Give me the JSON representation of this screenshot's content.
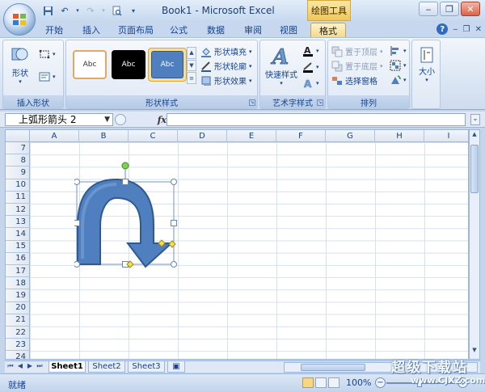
{
  "window": {
    "title": "Book1 - Microsoft Excel",
    "context_tab": "绘图工具"
  },
  "tabs": [
    "开始",
    "插入",
    "页面布局",
    "公式",
    "数据",
    "审阅",
    "视图",
    "格式"
  ],
  "active_tab": "格式",
  "ribbon": {
    "insert_shapes": {
      "label": "插入形状",
      "shapes_btn": "形状"
    },
    "shape_styles": {
      "label": "形状样式",
      "thumbs": [
        "Abc",
        "Abc",
        "Abc"
      ],
      "fill": "形状填充",
      "outline": "形状轮廓",
      "effects": "形状效果"
    },
    "wordart": {
      "label": "艺术字样式",
      "quick_styles": "快速样式"
    },
    "arrange": {
      "label": "排列",
      "bring_front": "置于顶层",
      "send_back": "置于底层",
      "selection_pane": "选择窗格"
    },
    "size": {
      "label": "大小"
    }
  },
  "formula_bar": {
    "name_box": "上弧形箭头 2",
    "fx": "fx"
  },
  "columns": [
    "A",
    "B",
    "C",
    "D",
    "E",
    "F",
    "G",
    "H",
    "I"
  ],
  "rows": [
    "7",
    "8",
    "9",
    "10",
    "11",
    "12",
    "13",
    "14",
    "15",
    "16",
    "17",
    "18",
    "19",
    "20",
    "21",
    "22",
    "23",
    "24"
  ],
  "sheets": [
    "Sheet1",
    "Sheet2",
    "Sheet3"
  ],
  "active_sheet": "Sheet1",
  "status": {
    "ready": "就绪",
    "zoom": "100%"
  },
  "watermark": {
    "line1": "超级下载站",
    "line2": "www.CJXZ.com"
  },
  "colors": {
    "accent": "#f3d98c",
    "shape_fill": "#4f7fbf",
    "shape_stroke": "#2e5a8f"
  }
}
